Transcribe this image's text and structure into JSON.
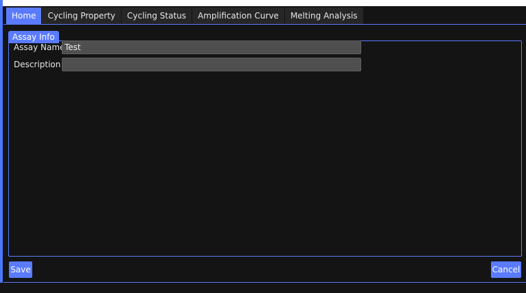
{
  "tabs": [
    {
      "label": "Home",
      "active": true
    },
    {
      "label": "Cycling Property",
      "active": false
    },
    {
      "label": "Cycling Status",
      "active": false
    },
    {
      "label": "Amplification Curve",
      "active": false
    },
    {
      "label": "Melting Analysis",
      "active": false
    }
  ],
  "assay_info": {
    "title": "Assay Info",
    "assay_name_label": "Assay Name",
    "assay_name_value": "Test",
    "description_label": "Description",
    "description_value": ""
  },
  "footer": {
    "save_label": "Save",
    "cancel_label": "Cancel"
  },
  "colors": {
    "accent": "#5a7bff",
    "background": "#141414",
    "input_background": "#4f4f4f",
    "tab_inactive": "#262626"
  }
}
